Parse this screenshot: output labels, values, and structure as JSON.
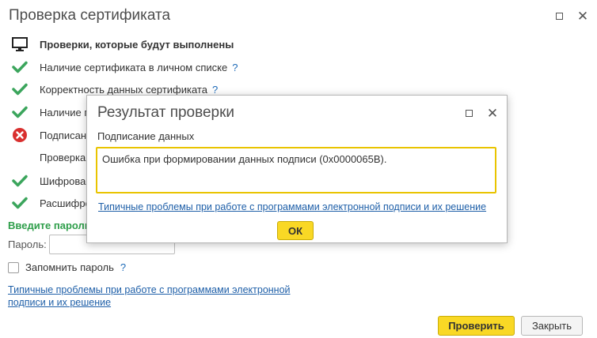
{
  "window": {
    "title": "Проверка сертификата"
  },
  "checks": {
    "header": "Проверки, которые будут выполнены",
    "items": [
      {
        "label": "Наличие сертификата в личном списке",
        "status": "ok",
        "help": "?"
      },
      {
        "label": "Корректность данных сертификата",
        "status": "ok",
        "help": "?"
      },
      {
        "label": "Наличие п",
        "status": "ok",
        "help": ""
      },
      {
        "label": "Подписани",
        "status": "error",
        "help": ""
      },
      {
        "label": "Проверка",
        "status": "none",
        "help": ""
      },
      {
        "label": "Шифрован",
        "status": "ok",
        "help": ""
      },
      {
        "label": "Расшифро",
        "status": "ok",
        "help": ""
      }
    ]
  },
  "password": {
    "prompt": "Введите пароль",
    "label": "Пароль:",
    "value": "",
    "remember_label": "Запомнить пароль",
    "remember_checked": false,
    "help": "?"
  },
  "link_text": "Типичные проблемы при работе с программами электронной подписи и их решение",
  "buttons": {
    "check": "Проверить",
    "close": "Закрыть"
  },
  "dialog": {
    "title": "Результат проверки",
    "subtitle": "Подписание данных",
    "error_text": "Ошибка при формировании данных подписи (0x0000065B).",
    "link_text": "Типичные проблемы при работе с программами электронной подписи и их решение",
    "ok_label": "ОК"
  },
  "colors": {
    "accent_yellow": "#f9d825",
    "ok_green": "#3ba55c",
    "error_red": "#d9302f",
    "link_blue": "#1e5fa8",
    "prompt_green": "#2e9e4a"
  }
}
